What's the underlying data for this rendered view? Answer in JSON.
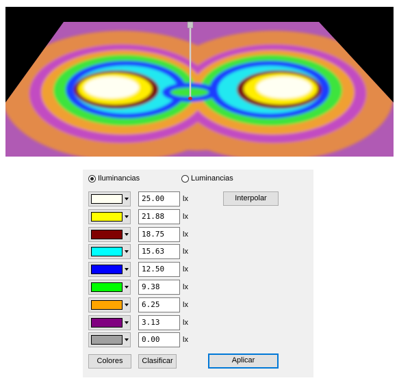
{
  "modes": {
    "illuminance_label": "Iluminancias",
    "luminance_label": "Luminancias",
    "selected": "illuminance"
  },
  "legend_rows": [
    {
      "color": "#fffff2",
      "value": "25.00",
      "unit": "lx"
    },
    {
      "color": "#ffff00",
      "value": "21.88",
      "unit": "lx"
    },
    {
      "color": "#800000",
      "value": "18.75",
      "unit": "lx"
    },
    {
      "color": "#00ffff",
      "value": "15.63",
      "unit": "lx"
    },
    {
      "color": "#0000ff",
      "value": "12.50",
      "unit": "lx"
    },
    {
      "color": "#00ff00",
      "value": "9.38",
      "unit": "lx"
    },
    {
      "color": "#ffa500",
      "value": "6.25",
      "unit": "lx"
    },
    {
      "color": "#800080",
      "value": "3.13",
      "unit": "lx"
    },
    {
      "color": "#a0a0a0",
      "value": "0.00",
      "unit": "lx"
    }
  ],
  "buttons": {
    "interpolate": "Interpolar",
    "colors": "Colores",
    "classify": "Clasificar",
    "apply": "Aplicar"
  },
  "viewport": {
    "background": "#000000",
    "accent": "#0078d7"
  }
}
